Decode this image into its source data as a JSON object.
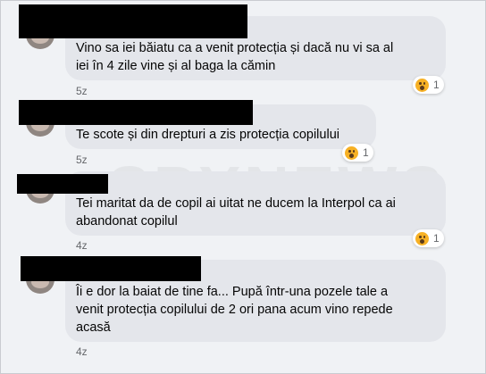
{
  "comments": [
    {
      "lines": [
        "Vino sa iei băiatu ca a venit protecția și dacă nu vi sa al",
        "iei în 4 zile vine și al baga la cămin"
      ],
      "time": "5z",
      "reaction_icon": "wow-emoji-icon",
      "reaction_count": "1"
    },
    {
      "lines": [
        "Te scote și din drepturi a zis protecția copilului"
      ],
      "time": "5z",
      "reaction_icon": "wow-emoji-icon",
      "reaction_count": "1"
    },
    {
      "lines": [
        "Tei maritat da de copil ai uitat ne ducem la Interpol ca ai",
        "abandonat copilul"
      ],
      "time": "4z",
      "reaction_icon": "wow-emoji-icon",
      "reaction_count": "1"
    },
    {
      "lines": [
        "Îi e dor la baiat de tine fa... Pupă într-una pozele tale a",
        "venit protecția copilului de 2 ori pana acum vino repede",
        "acasă"
      ],
      "time": "4z"
    }
  ],
  "colors": {
    "bubble": "#e4e6eb",
    "background": "#f0f2f5",
    "reaction": "#f7b125"
  }
}
